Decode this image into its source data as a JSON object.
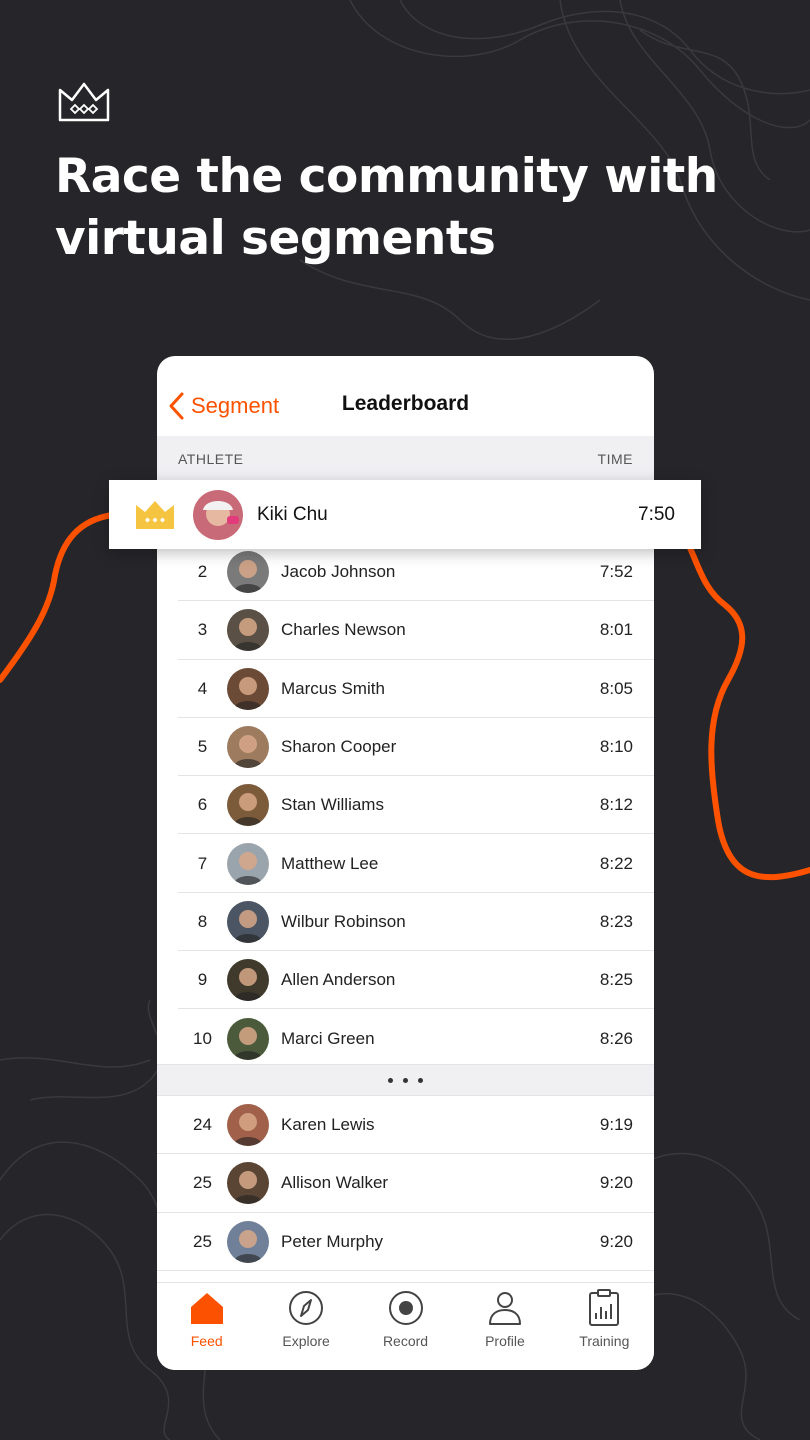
{
  "headline": "Race the community with virtual segments",
  "nav": {
    "back_label": "Segment",
    "title": "Leaderboard"
  },
  "columns": {
    "athlete": "ATHLETE",
    "time": "TIME"
  },
  "winner": {
    "name": "Kiki Chu",
    "time": "7:50"
  },
  "rows": [
    {
      "rank": "2",
      "name": "Jacob Johnson",
      "time": "7:52",
      "color": "#7a7a7a"
    },
    {
      "rank": "3",
      "name": "Charles Newson",
      "time": "8:01",
      "color": "#5a5045"
    },
    {
      "rank": "4",
      "name": "Marcus Smith",
      "time": "8:05",
      "color": "#6b4a36"
    },
    {
      "rank": "5",
      "name": "Sharon Cooper",
      "time": "8:10",
      "color": "#9c7b5f"
    },
    {
      "rank": "6",
      "name": "Stan Williams",
      "time": "8:12",
      "color": "#7c5b3b"
    },
    {
      "rank": "7",
      "name": "Matthew Lee",
      "time": "8:22",
      "color": "#9aa4ad"
    },
    {
      "rank": "8",
      "name": "Wilbur Robinson",
      "time": "8:23",
      "color": "#4b5563"
    },
    {
      "rank": "9",
      "name": "Allen Anderson",
      "time": "8:25",
      "color": "#3f3a2c"
    },
    {
      "rank": "10",
      "name": "Marci Green",
      "time": "8:26",
      "color": "#4a5a3a"
    }
  ],
  "rows_after_gap": [
    {
      "rank": "24",
      "name": "Karen Lewis",
      "time": "9:19",
      "color": "#a0604a"
    },
    {
      "rank": "25",
      "name": "Allison Walker",
      "time": "9:20",
      "color": "#5a4535"
    },
    {
      "rank": "25",
      "name": "Peter Murphy",
      "time": "9:20",
      "color": "#6f8098"
    }
  ],
  "tabs": [
    {
      "label": "Feed",
      "icon": "home-icon",
      "active": true
    },
    {
      "label": "Explore",
      "icon": "compass-icon",
      "active": false
    },
    {
      "label": "Record",
      "icon": "record-icon",
      "active": false
    },
    {
      "label": "Profile",
      "icon": "person-icon",
      "active": false
    },
    {
      "label": "Training",
      "icon": "training-icon",
      "active": false
    }
  ],
  "colors": {
    "accent": "#fc5200",
    "background": "#262529",
    "crown": "#f5c542"
  }
}
